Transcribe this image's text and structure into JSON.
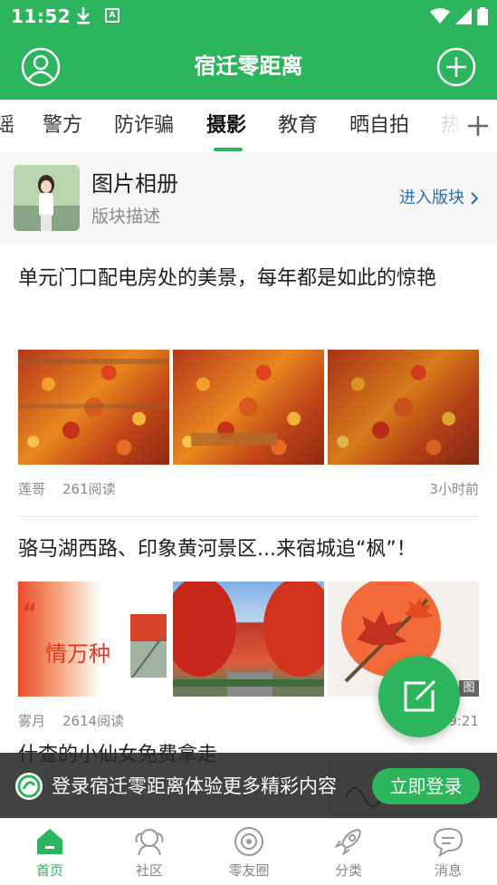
{
  "status_bar": {
    "time": "11:52"
  },
  "header": {
    "title": "宿迁零距离"
  },
  "tabs": [
    {
      "label": "谣"
    },
    {
      "label": "警方"
    },
    {
      "label": "防诈骗"
    },
    {
      "label": "摄影",
      "active": true
    },
    {
      "label": "教育"
    },
    {
      "label": "晒自拍"
    },
    {
      "label": "热"
    }
  ],
  "album": {
    "title": "图片相册",
    "description": "版块描述",
    "enter_label": "进入版块"
  },
  "posts": [
    {
      "title": "单元门口配电房处的美景，每年都是如此的惊艳",
      "author": "莲哥",
      "reads": "261阅读",
      "time": "3小时前"
    },
    {
      "title": "骆马湖西路、印象黄河景区...来宿城追“枫”！",
      "author": "雾月",
      "reads": "2614阅读",
      "time": "9:21",
      "image_overlay_text": "情万种",
      "image_overlay_quote": "“",
      "image_badge": "图"
    },
    {
      "title": "什查的小仙女免费拿走"
    }
  ],
  "login_banner": {
    "text": "登录宿迁零距离体验更多精彩内容",
    "button": "立即登录"
  },
  "bottom_nav": [
    {
      "label": "首页",
      "active": true,
      "icon": "home-icon"
    },
    {
      "label": "社区",
      "icon": "community-icon"
    },
    {
      "label": "零友圈",
      "icon": "friends-circle-icon"
    },
    {
      "label": "分类",
      "icon": "category-rocket-icon"
    },
    {
      "label": "消息",
      "icon": "message-icon"
    }
  ],
  "colors": {
    "brand": "#2db55d",
    "link": "#2a6fb5"
  }
}
